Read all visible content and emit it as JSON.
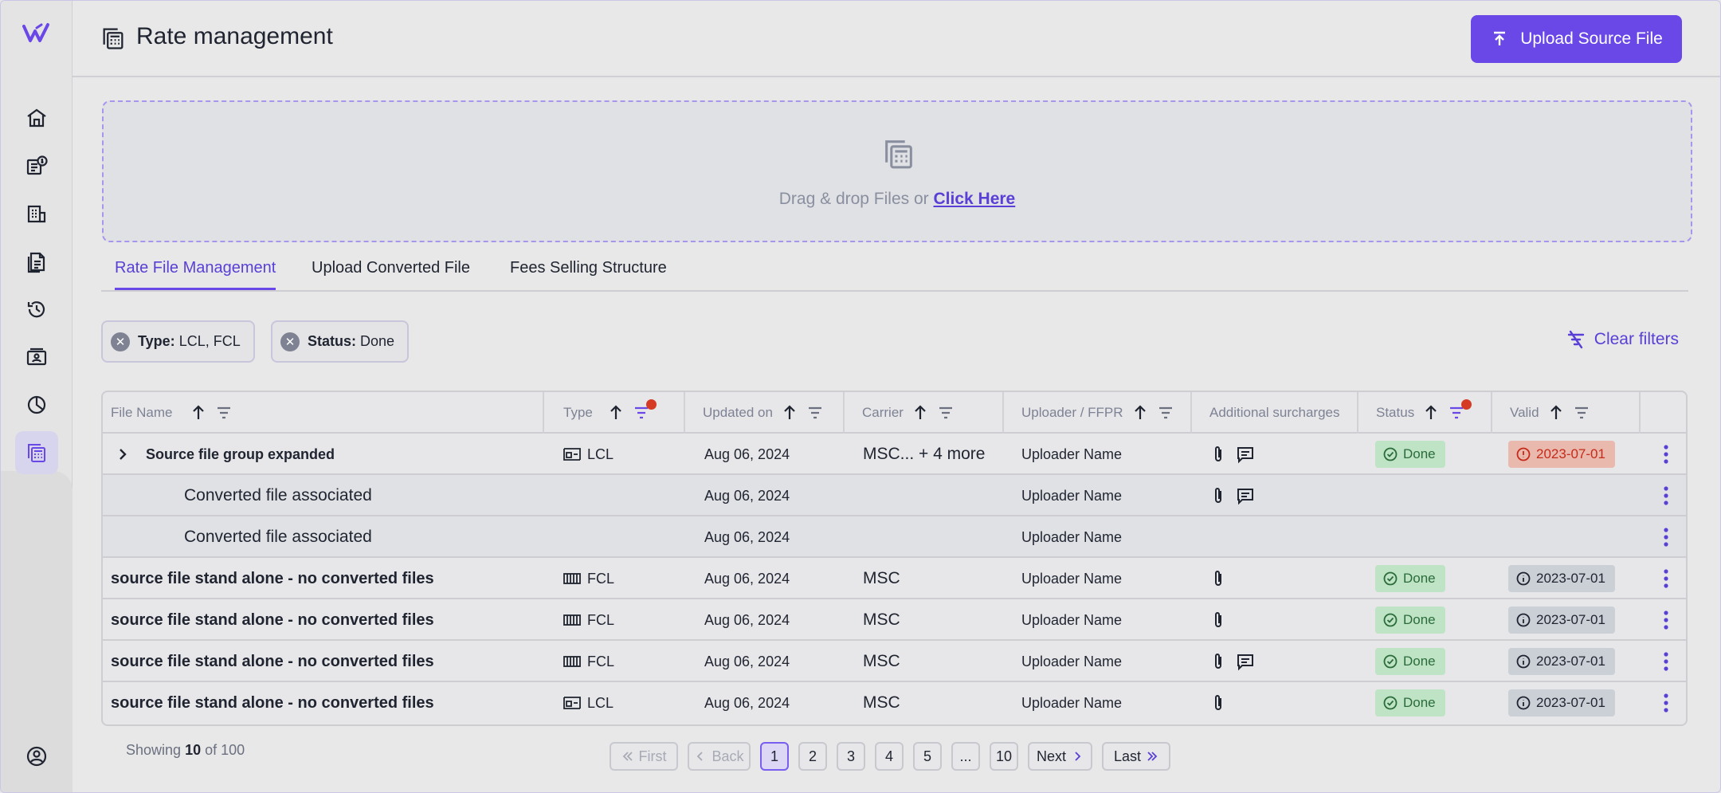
{
  "header": {
    "title": "Rate management",
    "upload_label": "Upload Source File"
  },
  "dropzone": {
    "text": "Drag & drop Files or",
    "link": "Click Here"
  },
  "tabs": [
    {
      "label": "Rate File Management",
      "active": true
    },
    {
      "label": "Upload Converted File",
      "active": false
    },
    {
      "label": "Fees Selling Structure",
      "active": false
    }
  ],
  "filters": [
    {
      "key": "Type:",
      "value": "LCL, FCL"
    },
    {
      "key": "Status:",
      "value": "Done"
    }
  ],
  "clear_filters": "Clear filters",
  "table": {
    "columns": {
      "file_name": "File Name",
      "type": "Type",
      "updated_on": "Updated on",
      "carrier": "Carrier",
      "uploader": "Uploader / FFPR",
      "surcharges": "Additional surcharges",
      "status": "Status",
      "valid": "Valid"
    },
    "rows": [
      {
        "name": "Source file group expanded",
        "type": "LCL",
        "updated": "Aug 06, 2024",
        "carrier": "MSC... + 4 more",
        "uploader": "Uploader Name",
        "status": "Done",
        "valid": "2023-07-01"
      },
      {
        "name": "Converted file associated",
        "updated": "Aug 06, 2024",
        "uploader": "Uploader Name"
      },
      {
        "name": "Converted file associated",
        "updated": "Aug 06, 2024",
        "uploader": "Uploader Name"
      },
      {
        "name": "source file stand alone - no converted files",
        "type": "FCL",
        "updated": "Aug 06, 2024",
        "carrier": "MSC",
        "uploader": "Uploader Name",
        "status": "Done",
        "valid": "2023-07-01"
      },
      {
        "name": "source file stand alone - no converted files",
        "type": "FCL",
        "updated": "Aug 06, 2024",
        "carrier": "MSC",
        "uploader": "Uploader Name",
        "status": "Done",
        "valid": "2023-07-01"
      },
      {
        "name": "source file stand alone - no converted files",
        "type": "FCL",
        "updated": "Aug 06, 2024",
        "carrier": "MSC",
        "uploader": "Uploader Name",
        "status": "Done",
        "valid": "2023-07-01"
      },
      {
        "name": "source file stand alone - no converted files",
        "type": "LCL",
        "updated": "Aug 06, 2024",
        "carrier": "MSC",
        "uploader": "Uploader Name",
        "status": "Done",
        "valid": "2023-07-01"
      }
    ]
  },
  "pagination": {
    "showing_prefix": "Showing",
    "showing_count": "10",
    "showing_suffix": "of 100",
    "first": "First",
    "back": "Back",
    "pages": [
      "1",
      "2",
      "3",
      "4",
      "5",
      "...",
      "10"
    ],
    "next": "Next",
    "last": "Last"
  },
  "colors": {
    "accent": "#6a48e8",
    "done": "#bfe3c5",
    "expired": "#eab9ae",
    "filter_dot": "#d53a24"
  },
  "icons": {
    "sidebar": [
      "home-icon",
      "money-icon",
      "building-icon",
      "documents-icon",
      "history-icon",
      "contact-card-icon",
      "pie-chart-icon",
      "calculator-icon",
      "user-circle-icon"
    ]
  }
}
